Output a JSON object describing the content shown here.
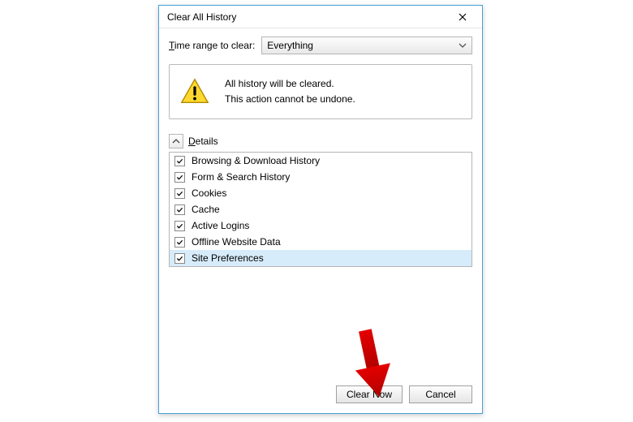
{
  "dialog": {
    "title": "Clear All History",
    "range_label_pre": "T",
    "range_label_rest": "ime range to clear:",
    "range_value": "Everything",
    "warning_line1": "All history will be cleared.",
    "warning_line2": "This action cannot be undone.",
    "details_label_pre": "D",
    "details_label_rest": "etails",
    "items": [
      {
        "label": "Browsing & Download History",
        "checked": true
      },
      {
        "label": "Form & Search History",
        "checked": true
      },
      {
        "label": "Cookies",
        "checked": true
      },
      {
        "label": "Cache",
        "checked": true
      },
      {
        "label": "Active Logins",
        "checked": true
      },
      {
        "label": "Offline Website Data",
        "checked": true
      },
      {
        "label": "Site Preferences",
        "checked": true,
        "highlight": true
      }
    ],
    "clear_button": "Clear Now",
    "cancel_button": "Cancel"
  },
  "colors": {
    "accent_arrow": "#d30000"
  }
}
